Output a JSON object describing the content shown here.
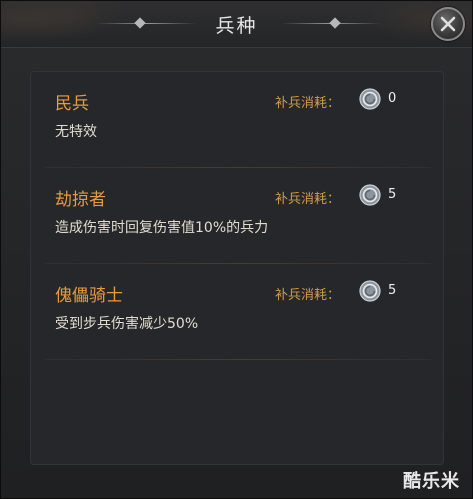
{
  "window": {
    "title": "兵种"
  },
  "units": [
    {
      "name": "民兵",
      "description": "无特效",
      "cost_label": "补兵消耗：",
      "cost_value": "0"
    },
    {
      "name": "劫掠者",
      "description": "造成伤害时回复伤害值10%的兵力",
      "cost_label": "补兵消耗：",
      "cost_value": "5"
    },
    {
      "name": "傀儡骑士",
      "description": "受到步兵伤害减少50%",
      "cost_label": "补兵消耗：",
      "cost_value": "5"
    }
  ],
  "watermark": "酷乐米",
  "icons": {
    "close": "close-icon",
    "coin": "silver-coin-icon"
  },
  "colors": {
    "unit_name": "#e89a3c",
    "cost_label": "#d49a4a",
    "description": "#e2dccf"
  }
}
